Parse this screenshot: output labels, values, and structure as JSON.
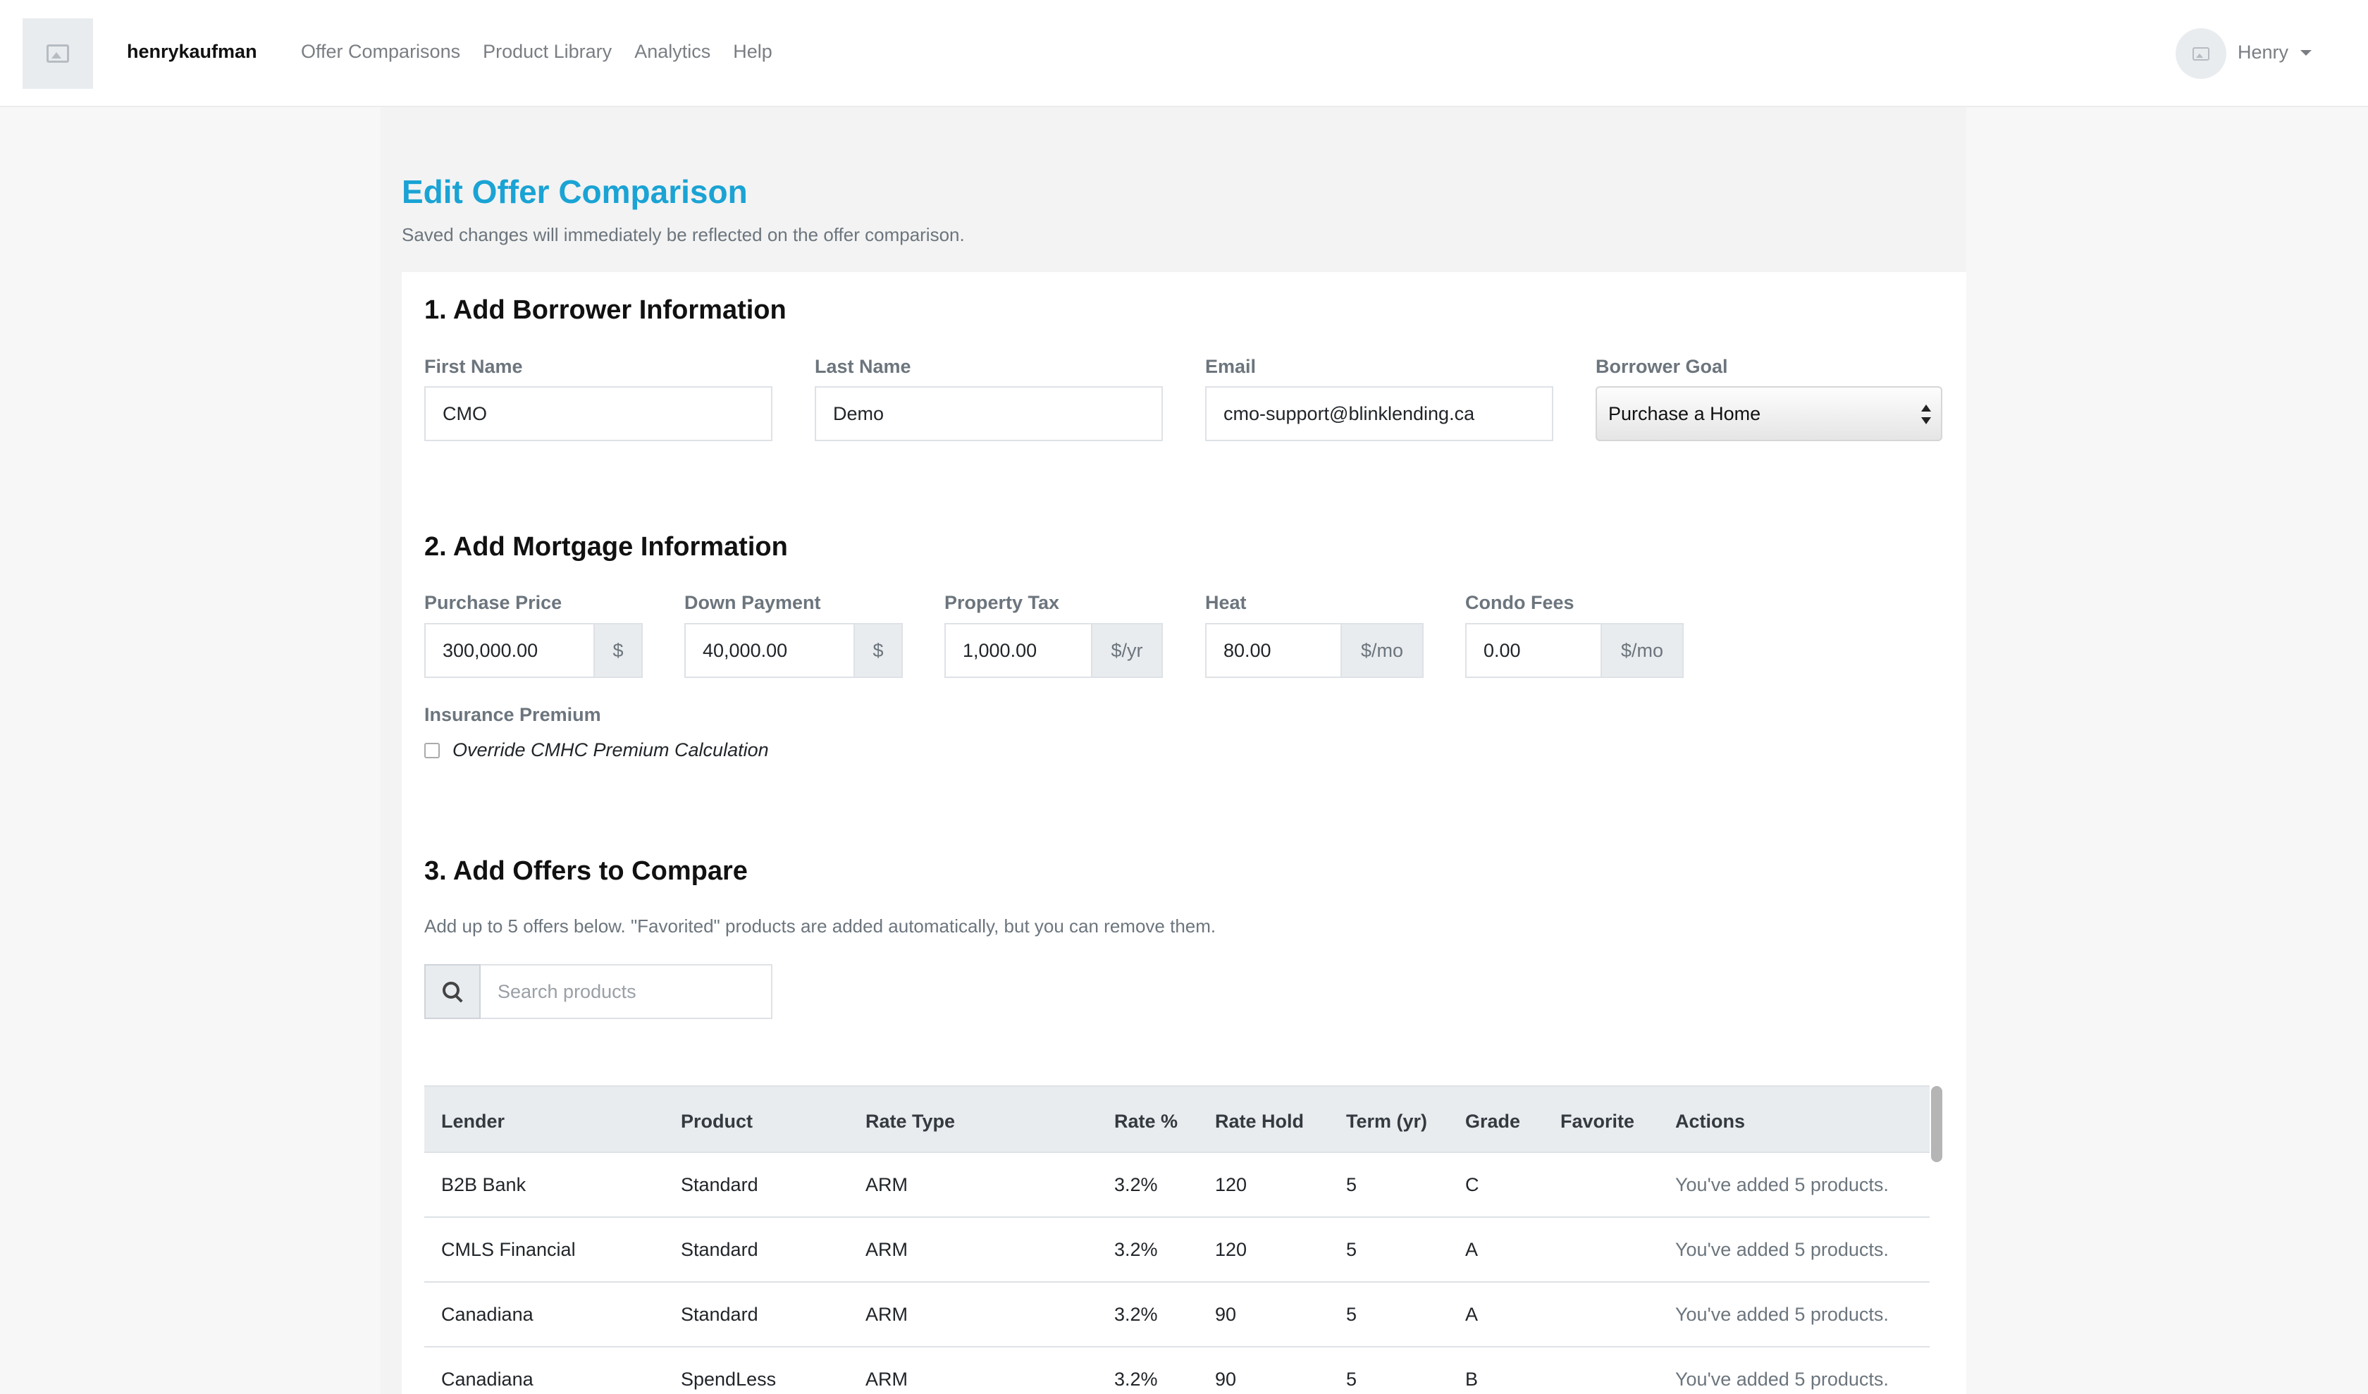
{
  "navbar": {
    "brand": "henrykaufman",
    "links": [
      "Offer Comparisons",
      "Product Library",
      "Analytics",
      "Help"
    ],
    "user": "Henry"
  },
  "page": {
    "title": "Edit Offer Comparison",
    "subtitle": "Saved changes will immediately be reflected on the offer comparison."
  },
  "borrower": {
    "section_title": "1. Add Borrower Information",
    "first_name_label": "First Name",
    "first_name": "CMO",
    "last_name_label": "Last Name",
    "last_name": "Demo",
    "email_label": "Email",
    "email": "cmo-support@blinklending.ca",
    "goal_label": "Borrower Goal",
    "goal": "Purchase a Home"
  },
  "mortgage": {
    "section_title": "2. Add Mortgage Information",
    "purchase_price_label": "Purchase Price",
    "purchase_price": "300,000.00",
    "purchase_price_unit": "$",
    "down_payment_label": "Down Payment",
    "down_payment": "40,000.00",
    "down_payment_unit": "$",
    "property_tax_label": "Property Tax",
    "property_tax": "1,000.00",
    "property_tax_unit": "$/yr",
    "heat_label": "Heat",
    "heat": "80.00",
    "heat_unit": "$/mo",
    "condo_fees_label": "Condo Fees",
    "condo_fees": "0.00",
    "condo_fees_unit": "$/mo",
    "insurance_label": "Insurance Premium",
    "override_label": "Override CMHC Premium Calculation"
  },
  "offers": {
    "section_title": "3. Add Offers to Compare",
    "description": "Add up to 5 offers below. \"Favorited\" products are added automatically, but you can remove them.",
    "search_placeholder": "Search products",
    "columns": [
      "Lender",
      "Product",
      "Rate Type",
      "Rate %",
      "Rate Hold",
      "Term (yr)",
      "Grade",
      "Favorite",
      "Actions"
    ],
    "rows": [
      {
        "lender": "B2B Bank",
        "product": "Standard",
        "rate_type": "ARM",
        "rate": "3.2%",
        "rate_hold": "120",
        "term": "5",
        "grade": "C",
        "favorite": "",
        "actions": "You've added 5 products."
      },
      {
        "lender": "CMLS Financial",
        "product": "Standard",
        "rate_type": "ARM",
        "rate": "3.2%",
        "rate_hold": "120",
        "term": "5",
        "grade": "A",
        "favorite": "",
        "actions": "You've added 5 products."
      },
      {
        "lender": "Canadiana",
        "product": "Standard",
        "rate_type": "ARM",
        "rate": "3.2%",
        "rate_hold": "90",
        "term": "5",
        "grade": "A",
        "favorite": "",
        "actions": "You've added 5 products."
      },
      {
        "lender": "Canadiana",
        "product": "SpendLess",
        "rate_type": "ARM",
        "rate": "3.2%",
        "rate_hold": "90",
        "term": "5",
        "grade": "B",
        "favorite": "",
        "actions": "You've added 5 products."
      }
    ]
  }
}
